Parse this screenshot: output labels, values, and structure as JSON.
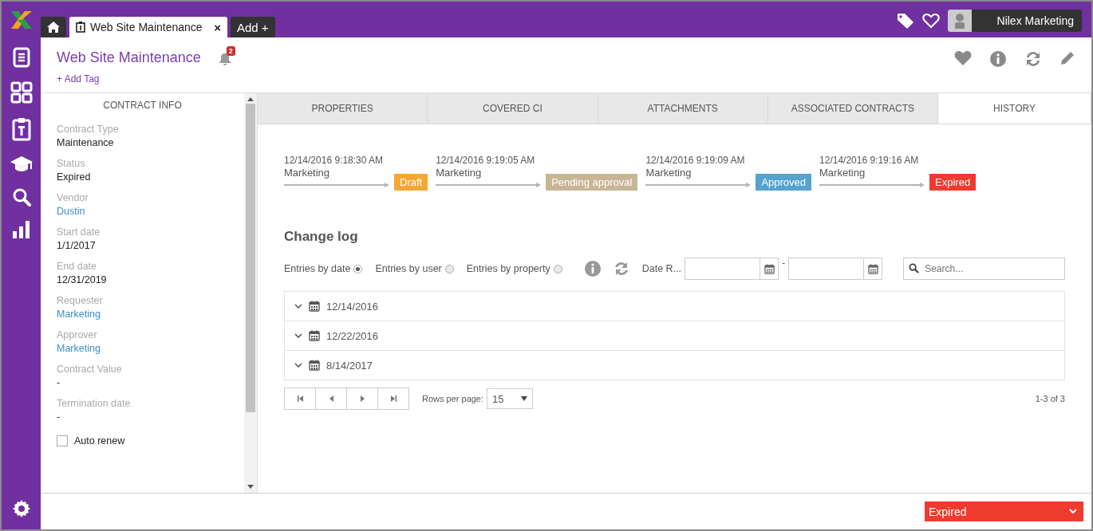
{
  "tabs": [
    {
      "kind": "home",
      "selected": false
    },
    {
      "kind": "record",
      "label": "Web Site Maintenance",
      "close": "×",
      "selected": true
    },
    {
      "kind": "add",
      "label": "Add +",
      "selected": false
    }
  ],
  "user": {
    "name": "Nilex Marketing"
  },
  "record": {
    "title": "Web Site Maintenance",
    "notifications": "2",
    "add_tag": "+ Add Tag"
  },
  "contract_info": {
    "title": "CONTRACT INFO",
    "fields": [
      {
        "label": "Contract Type",
        "value": "Maintenance",
        "kind": "text"
      },
      {
        "label": "Status",
        "value": "Expired",
        "kind": "text"
      },
      {
        "label": "Vendor",
        "value": "Dustin",
        "kind": "link"
      },
      {
        "label": "Start date",
        "value": "1/1/2017",
        "kind": "text"
      },
      {
        "label": "End date",
        "value": "12/31/2019",
        "kind": "text"
      },
      {
        "label": "Requester",
        "value": "Marketing",
        "kind": "link"
      },
      {
        "label": "Approver",
        "value": "Marketing",
        "kind": "link"
      },
      {
        "label": "Contract Value",
        "value": "-",
        "kind": "text"
      },
      {
        "label": "Termination date",
        "value": "-",
        "kind": "text"
      }
    ],
    "auto_renew": {
      "label": "Auto renew",
      "checked": false
    }
  },
  "detail_tabs": [
    {
      "label": "PROPERTIES",
      "selected": false
    },
    {
      "label": "COVERED CI",
      "selected": false
    },
    {
      "label": "ATTACHMENTS",
      "selected": false
    },
    {
      "label": "ASSOCIATED CONTRACTS",
      "selected": false
    },
    {
      "label": "HISTORY",
      "selected": true
    }
  ],
  "timeline": [
    {
      "time": "12/14/2016 9:18:30 AM",
      "user": "Marketing",
      "status": "Draft",
      "color": "#f5a733"
    },
    {
      "time": "12/14/2016 9:19:05 AM",
      "user": "Marketing",
      "status": "Pending approval",
      "color": "#c8b594"
    },
    {
      "time": "12/14/2016 9:19:09 AM",
      "user": "Marketing",
      "status": "Approved",
      "color": "#55a3cf"
    },
    {
      "time": "12/14/2016 9:19:16 AM",
      "user": "Marketing",
      "status": "Expired",
      "color": "#ee3a2f"
    }
  ],
  "change_log": {
    "title": "Change log",
    "view_options": [
      {
        "label": "Entries by date",
        "selected": true
      },
      {
        "label": "Entries by user",
        "selected": false
      },
      {
        "label": "Entries by property",
        "selected": false
      }
    ],
    "date_range_label": "Date R...",
    "range_separator": "-",
    "search_placeholder": "Search...",
    "groups": [
      {
        "date": "12/14/2016",
        "expanded": false
      },
      {
        "date": "12/22/2016",
        "expanded": false
      },
      {
        "date": "8/14/2017",
        "expanded": false
      }
    ],
    "rows_per_page_label": "Rows per page:",
    "rows_per_page": "15",
    "count": "1-3 of 3"
  },
  "footer": {
    "status": "Expired"
  }
}
